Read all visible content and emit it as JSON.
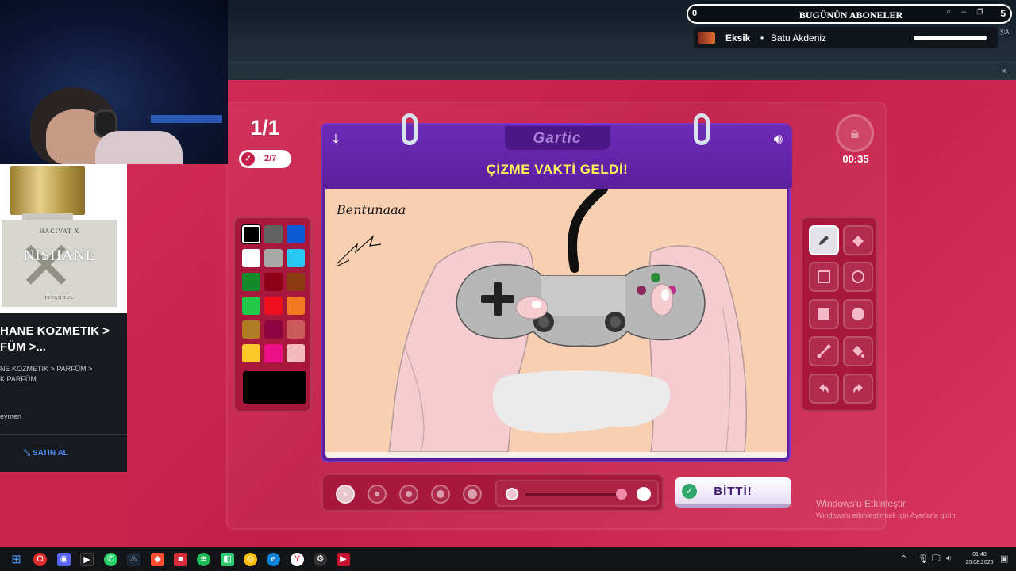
{
  "overlay": {
    "subscribers_count": "0",
    "subscribers_title": "BUGÜNÜN ABONELER",
    "subscribers_right": "5",
    "row_status": "Eksik",
    "row_dot": "•",
    "row_name": "Batu Akdeniz",
    "ai_tag": "ⓈAI"
  },
  "ad": {
    "brand_top": "HACIVAT X",
    "brand_main": "NISHANE",
    "brand_city": "ISTANBUL",
    "title": "HANE KOZMETIK >\nFÜM >...",
    "category": "NE KOZMETIK > PARFÜM >\nK PARFÜM",
    "seller": "eymen",
    "buy_label": "SATIN AL"
  },
  "game": {
    "round": "1/1",
    "players": "2/7",
    "timer": "00:35",
    "logo": "Gartic",
    "headline": "ÇİZME VAKTİ GELDİ!",
    "done_label": "BİTTİ!",
    "signature": "Bentunaaa",
    "palette": [
      "#000000",
      "#636363",
      "#0d5ad6",
      "#ffffff",
      "#a8a8a8",
      "#28c8f5",
      "#168a2a",
      "#8e0016",
      "#8c3c13",
      "#22c84a",
      "#ed0e1e",
      "#f27a22",
      "#ae7d23",
      "#8c0440",
      "#cc5a5a",
      "#fcc82a",
      "#ec0e84",
      "#f3b9bb"
    ],
    "selected_color": "#000000",
    "current_color": "#000000",
    "brush_sizes": 5,
    "selected_size": 1,
    "opacity": 0.85
  },
  "windows": {
    "watermark_title": "Windows'u Etkinleştir",
    "watermark_sub": "Windows'u etkinleştirmek için Ayarlar'a gidin.",
    "time": "01:48",
    "date": "25.08.2026"
  },
  "colors": {
    "game_bg": "#c8254a",
    "board": "#5b1f9e",
    "headline": "#fff35a",
    "panel": "#a8183d"
  }
}
